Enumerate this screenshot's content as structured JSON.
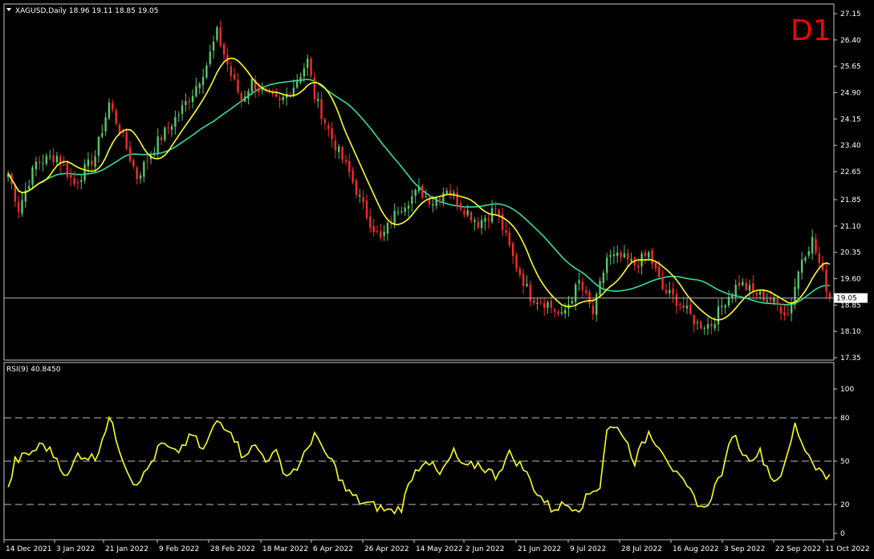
{
  "window": {
    "symbol_header": "XAGUSD,Daily  18.96 19.11 18.85 19.05",
    "timeframe_badge": "D1",
    "rsi_header": "RSI(9) 40.8450",
    "current_price_label": "19.05"
  },
  "colors": {
    "background": "#000000",
    "bull_candle": "#57c96b",
    "bear_candle": "#ff2a2a",
    "ma_fast": "#ffff22",
    "ma_slow": "#2fe0a0",
    "rsi_line": "#ffff22",
    "frame": "#c8c8c8",
    "text": "#ffffff",
    "badge": "#ff0000"
  },
  "chart_data": [
    {
      "type": "candlestick",
      "symbol": "XAGUSD",
      "timeframe": "Daily",
      "ylim": [
        17.35,
        27.15
      ],
      "y_ticks": [
        "27.15",
        "26.40",
        "25.65",
        "24.90",
        "24.15",
        "23.40",
        "22.65",
        "21.85",
        "21.10",
        "20.35",
        "19.60",
        "18.85",
        "18.10",
        "17.35"
      ],
      "x_tick_labels": [
        "14 Dec 2021",
        "3 Jan 2022",
        "21 Jan 2022",
        "9 Feb 2022",
        "28 Feb 2022",
        "18 Mar 2022",
        "6 Apr 2022",
        "26 Apr 2022",
        "14 May 2022",
        "2 Jun 2022",
        "21 Jun 2022",
        "9 Jul 2022",
        "28 Jul 2022",
        "16 Aug 2022",
        "3 Sep 2022",
        "22 Sep 2022",
        "11 Oct 2022"
      ],
      "current_price": 19.05,
      "close_anchors": [
        [
          0,
          22.6
        ],
        [
          3,
          21.6
        ],
        [
          8,
          22.9
        ],
        [
          14,
          23.1
        ],
        [
          19,
          22.3
        ],
        [
          25,
          23.1
        ],
        [
          29,
          24.6
        ],
        [
          33,
          23.6
        ],
        [
          37,
          22.5
        ],
        [
          43,
          23.5
        ],
        [
          49,
          24.3
        ],
        [
          53,
          24.9
        ],
        [
          57,
          25.7
        ],
        [
          60,
          26.6
        ],
        [
          64,
          25.4
        ],
        [
          67,
          24.7
        ],
        [
          70,
          25.2
        ],
        [
          73,
          24.9
        ],
        [
          78,
          24.6
        ],
        [
          82,
          25.1
        ],
        [
          86,
          25.8
        ],
        [
          88,
          24.8
        ],
        [
          93,
          23.6
        ],
        [
          98,
          22.6
        ],
        [
          103,
          21.4
        ],
        [
          107,
          20.7
        ],
        [
          112,
          21.6
        ],
        [
          118,
          22.1
        ],
        [
          122,
          21.8
        ],
        [
          126,
          22.2
        ],
        [
          130,
          21.7
        ],
        [
          135,
          21.2
        ],
        [
          140,
          21.6
        ],
        [
          145,
          20.2
        ],
        [
          150,
          19.1
        ],
        [
          155,
          18.9
        ],
        [
          159,
          18.5
        ],
        [
          164,
          19.5
        ],
        [
          168,
          18.6
        ],
        [
          172,
          20.2
        ],
        [
          176,
          20.2
        ],
        [
          180,
          20.0
        ],
        [
          184,
          20.3
        ],
        [
          188,
          19.3
        ],
        [
          193,
          18.9
        ],
        [
          198,
          18.3
        ],
        [
          202,
          18.3
        ],
        [
          206,
          19.0
        ],
        [
          210,
          19.5
        ],
        [
          214,
          19.2
        ],
        [
          219,
          19.0
        ],
        [
          224,
          18.6
        ],
        [
          228,
          20.2
        ],
        [
          231,
          20.7
        ],
        [
          234,
          19.7
        ],
        [
          236,
          19.05
        ]
      ],
      "ma_fast_period": 10,
      "ma_slow_period": 30
    },
    {
      "type": "line",
      "name": "RSI(9)",
      "last_value": 40.845,
      "ylim": [
        0,
        100
      ],
      "y_ticks": [
        100,
        80,
        50,
        20,
        0
      ],
      "levels": [
        80,
        50,
        20
      ],
      "anchors": [
        [
          0,
          30
        ],
        [
          2,
          50
        ],
        [
          6,
          55
        ],
        [
          10,
          62
        ],
        [
          14,
          52
        ],
        [
          17,
          38
        ],
        [
          20,
          55
        ],
        [
          25,
          52
        ],
        [
          29,
          80
        ],
        [
          33,
          52
        ],
        [
          36,
          35
        ],
        [
          39,
          40
        ],
        [
          44,
          62
        ],
        [
          48,
          55
        ],
        [
          53,
          68
        ],
        [
          56,
          57
        ],
        [
          60,
          78
        ],
        [
          64,
          72
        ],
        [
          67,
          55
        ],
        [
          71,
          60
        ],
        [
          74,
          52
        ],
        [
          77,
          55
        ],
        [
          80,
          40
        ],
        [
          84,
          48
        ],
        [
          88,
          70
        ],
        [
          90,
          58
        ],
        [
          93,
          50
        ],
        [
          97,
          30
        ],
        [
          101,
          22
        ],
        [
          105,
          19
        ],
        [
          110,
          15
        ],
        [
          113,
          18
        ],
        [
          116,
          40
        ],
        [
          120,
          52
        ],
        [
          124,
          40
        ],
        [
          128,
          56
        ],
        [
          131,
          45
        ],
        [
          135,
          48
        ],
        [
          140,
          40
        ],
        [
          144,
          55
        ],
        [
          148,
          45
        ],
        [
          152,
          28
        ],
        [
          156,
          17
        ],
        [
          160,
          20
        ],
        [
          164,
          18
        ],
        [
          168,
          30
        ],
        [
          170,
          33
        ],
        [
          172,
          73
        ],
        [
          176,
          72
        ],
        [
          180,
          50
        ],
        [
          184,
          70
        ],
        [
          188,
          58
        ],
        [
          192,
          40
        ],
        [
          196,
          28
        ],
        [
          200,
          16
        ],
        [
          203,
          32
        ],
        [
          206,
          48
        ],
        [
          208,
          70
        ],
        [
          212,
          52
        ],
        [
          216,
          56
        ],
        [
          220,
          36
        ],
        [
          223,
          45
        ],
        [
          226,
          75
        ],
        [
          229,
          58
        ],
        [
          232,
          47
        ],
        [
          235,
          38
        ],
        [
          236,
          40.8
        ]
      ]
    }
  ]
}
